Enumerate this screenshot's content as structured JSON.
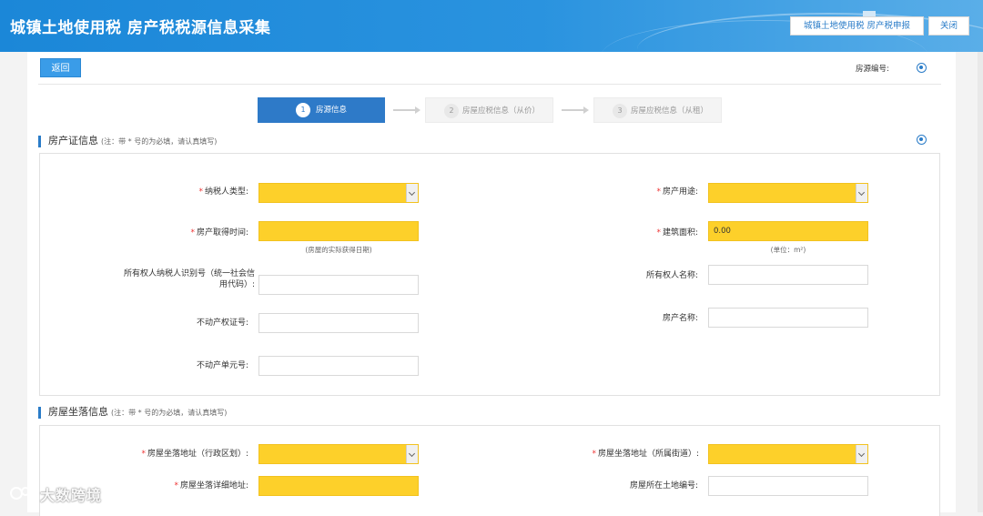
{
  "header": {
    "title": "城镇土地使用税 房产税税源信息采集",
    "declare_label": "城镇土地使用税 房产税申报",
    "close_label": "关闭"
  },
  "toolbar": {
    "back_label": "返回",
    "source_no_label": "房源编号:"
  },
  "steps": [
    {
      "num": "1",
      "label": "房源信息"
    },
    {
      "num": "2",
      "label": "房屋应税信息（从价）"
    },
    {
      "num": "3",
      "label": "房屋应税信息（从租）"
    }
  ],
  "section1": {
    "title": "房产证信息",
    "note": "(注：带 * 号的为必填，请认真填写)",
    "taxpayer_type_label": "纳税人类型:",
    "usage_label": "房产用途:",
    "acquire_time_label": "房产取得时间:",
    "acquire_time_hint": "(房屋的实际获得日期)",
    "area_label": "建筑面积:",
    "area_value": "0.00",
    "area_hint": "(单位：m²)",
    "owner_id_label_1": "所有权人纳税人识别号（统一社会信",
    "owner_id_label_2": "用代码）:",
    "owner_name_label": "所有权人名称:",
    "cert_no_label": "不动产权证号:",
    "property_name_label": "房产名称:",
    "unit_no_label": "不动产单元号:"
  },
  "section2": {
    "title": "房屋坐落信息",
    "note": "(注：带 * 号的为必填，请认真填写)",
    "district_label": "房屋坐落地址（行政区划）:",
    "street_label": "房屋坐落地址（所属街道）:",
    "detail_label": "房屋坐落详细地址:",
    "land_no_label": "房屋所在土地编号:"
  },
  "watermark": "大数跨境",
  "colors": {
    "header": "#1b87d8",
    "required_field": "#fdd02a",
    "active_step": "#2e7ac8",
    "required_star": "#ee3333"
  }
}
